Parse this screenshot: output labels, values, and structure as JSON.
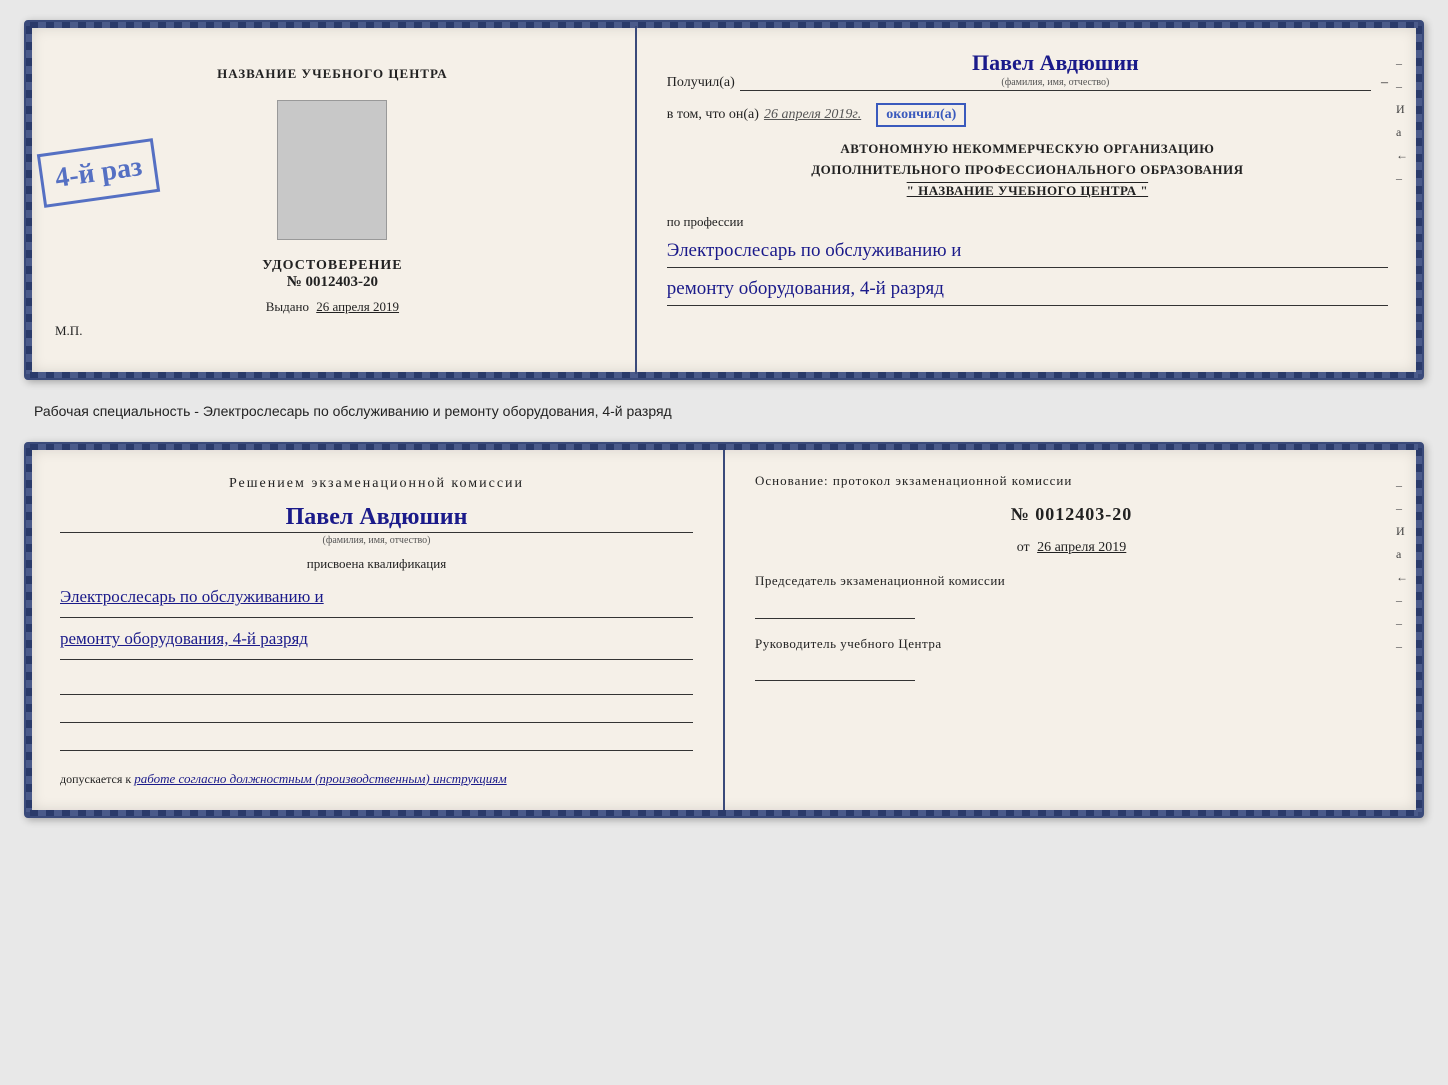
{
  "doc1": {
    "left": {
      "center_title": "НАЗВАНИЕ УЧЕБНОГО ЦЕНТРА",
      "udostoverenie": "УДОСТОВЕРЕНИЕ",
      "number": "№ 0012403-20",
      "vydano_label": "Выдано",
      "vydano_date": "26 апреля 2019",
      "mp_label": "М.П."
    },
    "right": {
      "poluchil_label": "Получил(a)",
      "poluchil_name": "Павел Авдюшин",
      "fio_label": "(фамилия, имя, отчество)",
      "vtom_text": "в том, что он(а)",
      "date_handwritten": "26 апреля 2019г.",
      "okonchil_label": "окончил(а)",
      "org_line1": "АВТОНОМНУЮ НЕКОММЕРЧЕСКУЮ ОРГАНИЗАЦИЮ",
      "org_line2": "ДОПОЛНИТЕЛЬНОГО ПРОФЕССИОНАЛЬНОГО ОБРАЗОВАНИЯ",
      "org_line3": "\" НАЗВАНИЕ УЧЕБНОГО ЦЕНТРА \"",
      "po_professii": "по профессии",
      "profession_text": "Электрослесарь по обслуживанию и",
      "profession_text2": "ремонту оборудования, 4-й разряд",
      "stamp_text": "4-й раз"
    }
  },
  "between": {
    "text": "Рабочая специальность - Электрослесарь по обслуживанию и ремонту оборудования, 4-й разряд"
  },
  "doc2": {
    "left": {
      "resheniem_text": "Решением экзаменационной комиссии",
      "name": "Павел Авдюшин",
      "fio_label": "(фамилия, имя, отчество)",
      "prisvoena_text": "присвоена квалификация",
      "profession_line1": "Электрослесарь по обслуживанию и",
      "profession_line2": "ремонту оборудования, 4-й разряд",
      "dopuskaetsya_label": "допускается к",
      "dopuskaetsya_text": "работе согласно должностным (производственным) инструкциям"
    },
    "right": {
      "osnovanie_text": "Основание: протокол экзаменационной комиссии",
      "number": "№  0012403-20",
      "ot_label": "от",
      "ot_date": "26 апреля 2019",
      "predsedatel_title": "Председатель экзаменационной комиссии",
      "rukovoditel_title": "Руководитель учебного Центра"
    }
  },
  "side_marks": {
    "items": [
      "–",
      "–",
      "И",
      "а",
      "←",
      "–",
      "–",
      "–"
    ]
  }
}
